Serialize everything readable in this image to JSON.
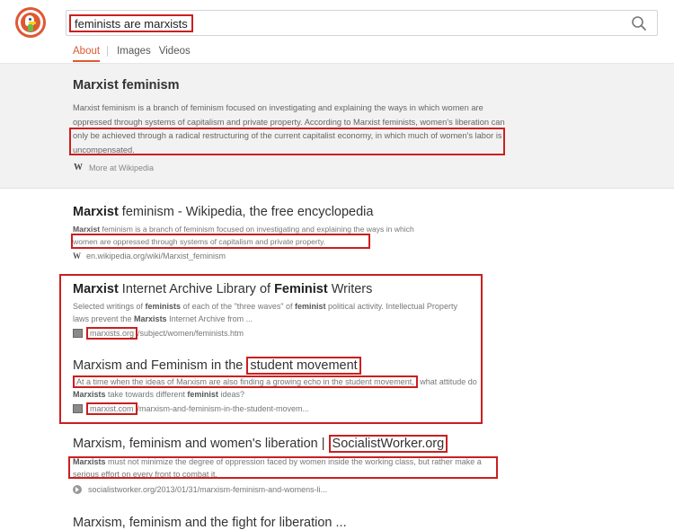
{
  "search": {
    "query": "feminists are marxists"
  },
  "tabs": [
    "About",
    "Images",
    "Videos"
  ],
  "about": {
    "title": "Marxist feminism",
    "text_part1": "Marxist feminism is a branch of feminism focused on investigating and explaining the ways in which women are oppressed through systems of capitalism and private property. According to Marxist",
    "text_highlight": "feminists, women's liberation can only be achieved through a radical restructuring of the current capitalist economy, in which much of women's labor is uncompensated.",
    "more": "More at Wikipedia"
  },
  "results": [
    {
      "title_bold": "Marxist",
      "title_rest": " feminism - Wikipedia, the free encyclopedia",
      "snippet_bold": "Marxist",
      "snippet_line1": " feminism is a branch of feminism focused on investigating and explaining the ways in which",
      "snippet_line2": "women are oppressed through systems of capitalism and private property.",
      "url": "en.wikipedia.org/wiki/Marxist_feminism"
    },
    {
      "t1": "Marxist",
      "t2": " Internet Archive Library of ",
      "t3": "Feminist",
      "t4": " Writers",
      "s1": "Selected writings of ",
      "s2": "feminists",
      "s3": " of each of the \"three waves\" of ",
      "s4": "feminist",
      "s5": " political activity. Intellectual Property laws prevent the ",
      "s6": "Marxists",
      "s7": " Internet Archive from ...",
      "url_hl": "marxists.org",
      "url_rest": "/subject/women/feminists.htm"
    },
    {
      "title_plain": "Marxism and Feminism in the ",
      "title_hl": "student movement",
      "snippet_hl": "At a time when the ideas of Marxism are also finding a growing echo in the student movement,",
      "snippet_rest1": " what attitude do ",
      "snippet_bold1": "Marxists",
      "snippet_rest2": " take towards different ",
      "snippet_bold2": "feminist",
      "snippet_rest3": " ideas?",
      "url_hl": "marxist.com",
      "url_rest": "/marxism-and-feminism-in-the-student-movem..."
    },
    {
      "title_plain": "Marxism, feminism and women's liberation | ",
      "title_hl": "SocialistWorker.org",
      "snippet_bold": "Marxists",
      "snippet_rest": " must not minimize the degree of oppression faced by women inside the working class, but rather make a serious effort on every front to combat it.",
      "url": "socialistworker.org/2013/01/31/marxism-feminism-and-womens-li..."
    },
    {
      "title": "Marxism, feminism and the fight for liberation ..."
    }
  ]
}
